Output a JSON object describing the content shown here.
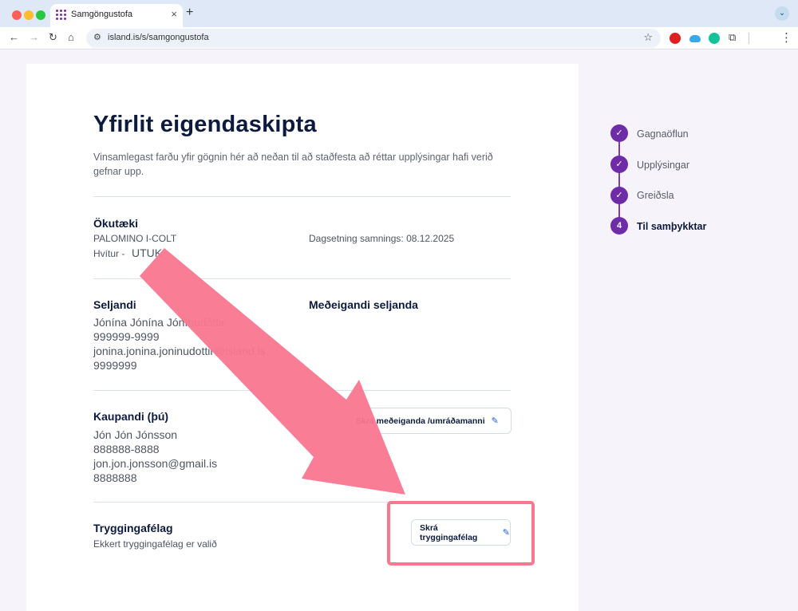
{
  "browser": {
    "tab_title": "Samgöngustofa",
    "url": "island.is/s/samgongustofa"
  },
  "page": {
    "title": "Yfirlit eigendaskipta",
    "intro": "Vinsamlegast farðu yfir gögnin hér að neðan til að staðfesta að réttar upplýsingar hafi verið gefnar upp."
  },
  "vehicle": {
    "heading": "Ökutæki",
    "model": "PALOMINO I-COLT",
    "color_prefix": "Hvítur -",
    "plate": "UTUK",
    "contract_date": "Dagsetning samnings: 08.12.2025"
  },
  "seller": {
    "heading": "Seljandi",
    "name": "Jónína Jónína Jónínudóttir",
    "phone": "999999-9999",
    "email": "jonina.jonina.joninudottir@island.is",
    "id": "9999999",
    "co_owner_heading": "Meðeigandi seljanda"
  },
  "buyer": {
    "heading": "Kaupandi (þú)",
    "name": "Jón Jón Jónsson",
    "phone": "888888-8888",
    "email": "jon.jon.jonsson@gmail.is",
    "id": "8888888",
    "button_label": "Skrá meðeiganda /umráðamanni"
  },
  "insurance": {
    "heading": "Tryggingafélag",
    "text": "Ekkert tryggingafélag er valið",
    "button_label": "Skrá tryggingafélag"
  },
  "stepper": [
    {
      "label": "Gagnaöflun",
      "state": "done"
    },
    {
      "label": "Upplýsingar",
      "state": "done"
    },
    {
      "label": "Greiðsla",
      "state": "done"
    },
    {
      "label": "Til samþykktar",
      "state": "active",
      "number": "4"
    }
  ],
  "colors": {
    "accent": "#6f2ca8",
    "annotation": "#f9778f",
    "title": "#0c1a3d"
  }
}
